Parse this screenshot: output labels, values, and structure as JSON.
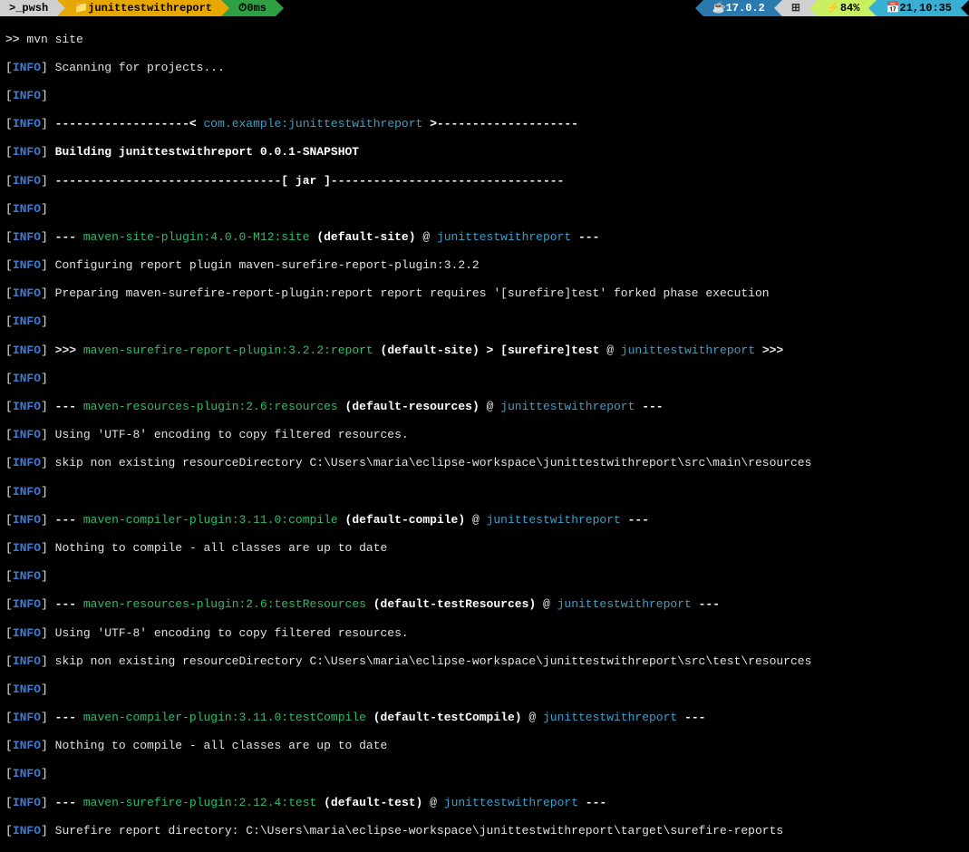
{
  "statusbar": {
    "shell_icon": ">_",
    "shell": "pwsh",
    "folder_icon": "📁",
    "folder": "junittestwithreport",
    "exec_icon": "⏱",
    "exec_time": "0ms",
    "java_icon": "☕",
    "java": "17.0.2",
    "win_icon": "⊞",
    "batt_icon": "⚡",
    "battery": "84%",
    "clock_icon": "📅",
    "clock": "21,10:35"
  },
  "prompt": {
    "symbol": ">>",
    "command": "mvn site"
  },
  "tags": {
    "info": "INFO",
    "lb": "[",
    "rb": "]"
  },
  "rules": {
    "hdr_pre": "-------------------< ",
    "hdr_mid": "com.example:junittestwithreport",
    "hdr_post": " >--------------------",
    "jar": "--------------------------------[ jar ]---------------------------------"
  },
  "text": {
    "scanning": " Scanning for projects...",
    "building": " Building junittestwithreport 0.0.1-SNAPSHOT",
    "cfg_surefire": " Configuring report plugin maven-surefire-report-plugin:3.2.2",
    "prep_surefire": " Preparing maven-surefire-report-plugin:report report requires '[surefire]test' forked phase execution",
    "utf8": " Using 'UTF-8' encoding to copy filtered resources.",
    "skip_main": " skip non existing resourceDirectory C:\\Users\\maria\\eclipse-workspace\\junittestwithreport\\src\\main\\resources",
    "nothing_compile": " Nothing to compile - all classes are up to date",
    "skip_test": " skip non existing resourceDirectory C:\\Users\\maria\\eclipse-workspace\\junittestwithreport\\src\\test\\resources",
    "surefire_dir": " Surefire report directory: C:\\Users\\maria\\eclipse-workspace\\junittestwithreport\\target\\surefire-reports"
  },
  "goals": {
    "site": "maven-site-plugin:4.0.0-M12:site",
    "surefire_report": "maven-surefire-report-plugin:3.2.2:report",
    "resources": "maven-resources-plugin:2.6:resources",
    "compile": "maven-compiler-plugin:3.11.0:compile",
    "test_resources": "maven-resources-plugin:2.6:testResources",
    "test_compile": "maven-compiler-plugin:3.11.0:testCompile",
    "surefire_test": "maven-surefire-plugin:2.12.4:test"
  },
  "exec": {
    "d3": "--- ",
    "a3o": ">>> ",
    "a3c": " >>>",
    "default_site": " (default-site) ",
    "surefire_chain": " (default-site) > [surefire]test ",
    "default_resources": " (default-resources) ",
    "default_compile": " (default-compile) ",
    "default_testResources": " (default-testResources) ",
    "default_testCompile": " (default-testCompile) ",
    "default_test": " (default-test) ",
    "at": "@ ",
    "trail": " ---"
  },
  "project": "junittestwithreport"
}
